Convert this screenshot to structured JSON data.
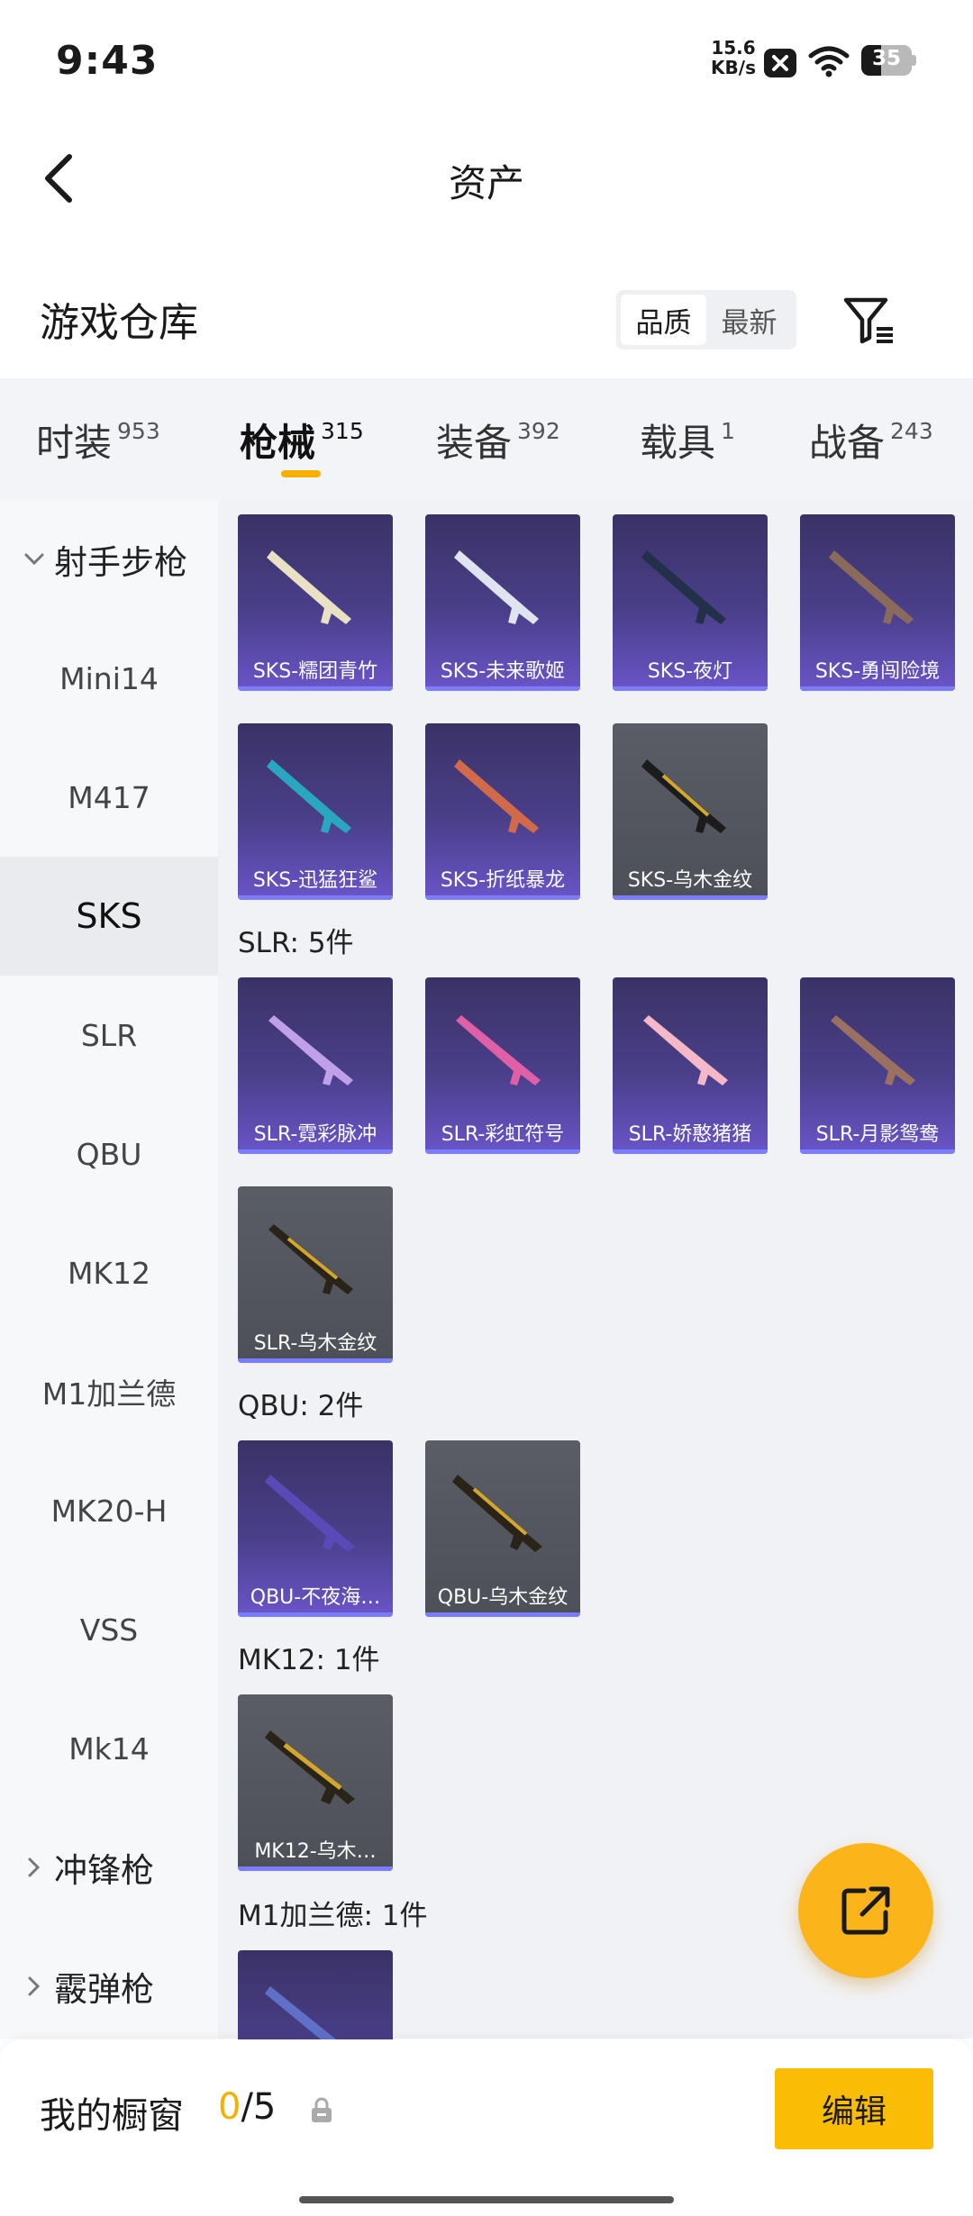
{
  "status_bar": {
    "time": "9:43",
    "speed_value": "15.6",
    "speed_unit": "KB/s",
    "battery": "35"
  },
  "header": {
    "title": "资产"
  },
  "section": {
    "title": "游戏仓库",
    "sort_options": [
      "品质",
      "最新"
    ],
    "active_sort": "品质"
  },
  "tabs": [
    {
      "label": "时装",
      "count": "953"
    },
    {
      "label": "枪械",
      "count": "315"
    },
    {
      "label": "装备",
      "count": "392"
    },
    {
      "label": "载具",
      "count": "1"
    },
    {
      "label": "战备",
      "count": "243"
    }
  ],
  "active_tab": "枪械",
  "categories": [
    {
      "label": "射手步枪",
      "type": "group-open"
    },
    {
      "label": "Mini14"
    },
    {
      "label": "M417"
    },
    {
      "label": "SKS",
      "active": true
    },
    {
      "label": "SLR"
    },
    {
      "label": "QBU"
    },
    {
      "label": "MK12"
    },
    {
      "label": "M1加兰德"
    },
    {
      "label": "MK20-H"
    },
    {
      "label": "VSS"
    },
    {
      "label": "Mk14"
    },
    {
      "label": "冲锋枪",
      "type": "group-closed"
    },
    {
      "label": "霰弹枪",
      "type": "group-closed"
    }
  ],
  "groups": {
    "sks": {
      "items": [
        "SKS-糯团青竹",
        "SKS-未来歌姬",
        "SKS-夜灯",
        "SKS-勇闯险境",
        "SKS-迅猛狂鲨",
        "SKS-折纸暴龙",
        "SKS-乌木金纹"
      ]
    },
    "slr": {
      "label": "SLR: 5件",
      "items": [
        "SLR-霓彩脉冲",
        "SLR-彩虹符号",
        "SLR-娇憨猪猪",
        "SLR-月影鸳鸯",
        "SLR-乌木金纹"
      ]
    },
    "qbu": {
      "label": "QBU: 2件",
      "items": [
        "QBU-不夜海…",
        "QBU-乌木金纹"
      ]
    },
    "mk12": {
      "label": "MK12: 1件",
      "items": [
        "MK12-乌木…"
      ]
    },
    "m1": {
      "label": "M1加兰德: 1件"
    }
  },
  "bottom_bar": {
    "label": "我的橱窗",
    "current": "0",
    "total": "/5",
    "edit_label": "编辑"
  },
  "colors": {
    "accent": "#fbbc05",
    "tab_underline": "#f5b100",
    "card_purple": "#4a3f8a",
    "card_gray": "#55585f"
  }
}
